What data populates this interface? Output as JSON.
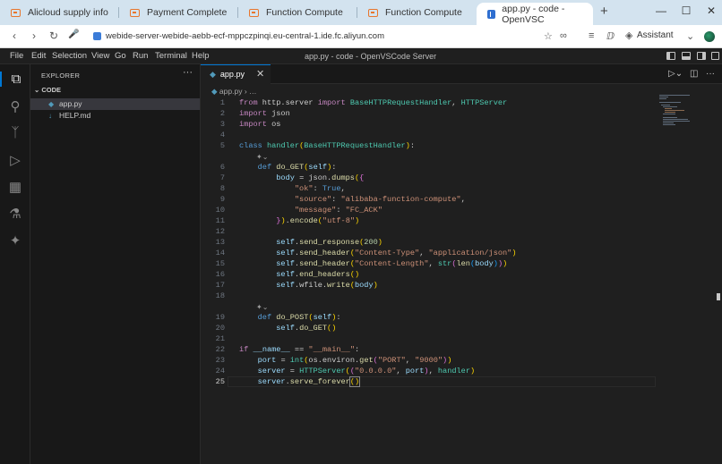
{
  "browser": {
    "tabs": [
      {
        "title": "Alicloud supply info"
      },
      {
        "title": "Payment Complete"
      },
      {
        "title": "Function Compute"
      },
      {
        "title": "Function Compute"
      },
      {
        "title": "app.py - code - OpenVSC"
      }
    ],
    "new_tab_icon": "plus-icon",
    "url": "webide-server-webide-aebb-ecf-mppczpinqi.eu-central-1.ide.fc.aliyun.com",
    "assistant_label": "Assistant",
    "accent_color": "#e8762d"
  },
  "vscode": {
    "menu": [
      "File",
      "Edit",
      "Selection",
      "View",
      "Go",
      "Run",
      "Terminal",
      "Help"
    ],
    "window_title": "app.py - code - OpenVSCode Server",
    "explorer": {
      "title": "EXPLORER",
      "more": "···",
      "folder": "CODE",
      "files": [
        {
          "name": "app.py",
          "icon": "python-file-icon"
        },
        {
          "name": "HELP.md",
          "icon": "markdown-file-icon"
        }
      ]
    },
    "editor_tab": {
      "label": "app.py"
    },
    "breadcrumb": {
      "file": "app.py",
      "rest": "…"
    },
    "code_lines": [
      "1",
      "2",
      "3",
      "4",
      "5",
      "6",
      "7",
      "8",
      "9",
      "10",
      "11",
      "12",
      "13",
      "14",
      "15",
      "16",
      "17",
      "18",
      "19",
      "20",
      "21",
      "22",
      "23",
      "24",
      "25"
    ],
    "current_line": "25",
    "accent_color": "#0078d4"
  }
}
